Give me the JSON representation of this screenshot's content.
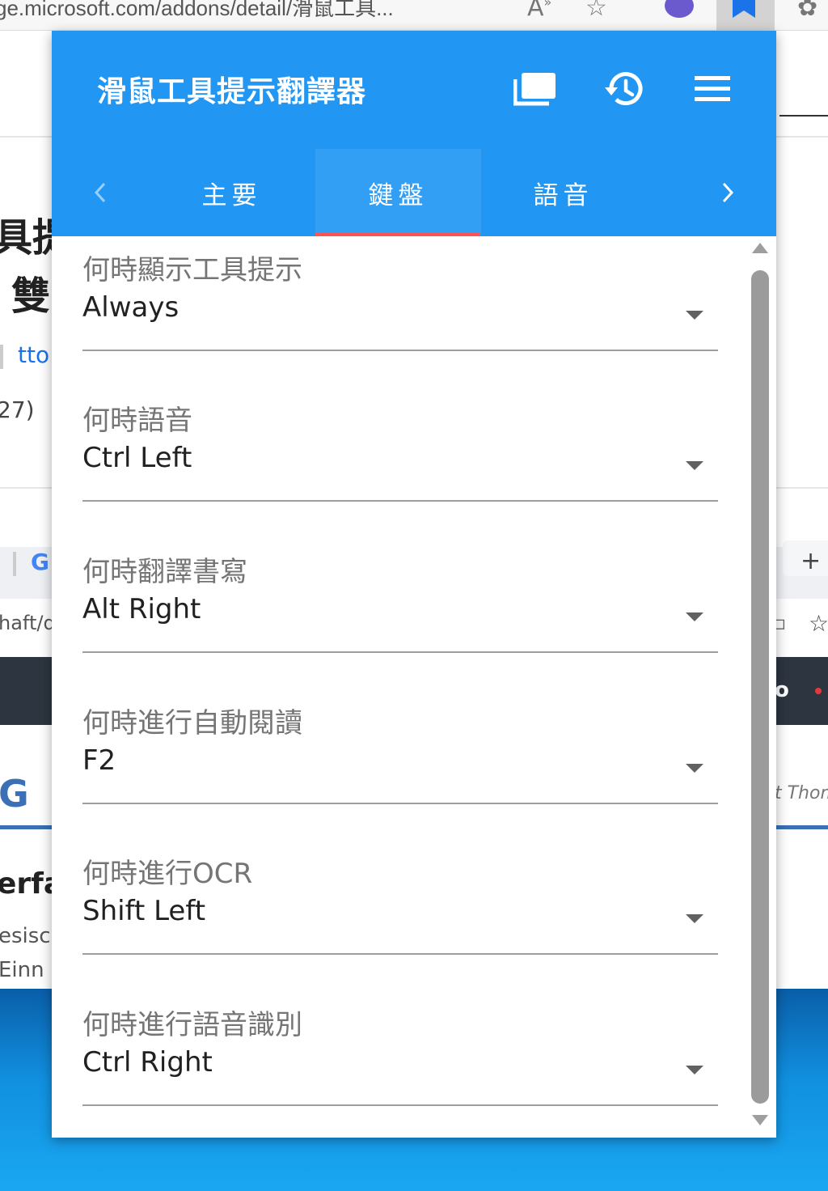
{
  "browser": {
    "address_text": "ge.microsoft.com/addons/detail/滑鼠工具...",
    "read_aloud_icon": "read-aloud-icon",
    "favorite_icon": "star-icon",
    "extensions_icon": "puzzle-icon"
  },
  "background_page": {
    "heading_fragment_1": "具提",
    "heading_fragment_2": "雙",
    "link_fragment": "tto",
    "rating_count_fragment": "27)",
    "bookmark_fragment": "haft/d",
    "logo_fragment": "G",
    "product_fragment": "erfa",
    "text_fragment_1": "esisc",
    "text_fragment_2": "Einn",
    "right_text_fragment": "t Thom",
    "new_tab_symbol": "+",
    "right_dark_fragment": "o"
  },
  "popup": {
    "title": "滑鼠工具提示翻譯器",
    "toolbar_icons": [
      "window-icon",
      "history-icon",
      "menu-icon"
    ],
    "tabs": [
      {
        "label": "主要",
        "active": false
      },
      {
        "label": "鍵盤",
        "active": true
      },
      {
        "label": "語音",
        "active": false
      }
    ],
    "fields": [
      {
        "label": "何時顯示工具提示",
        "value": "Always"
      },
      {
        "label": "何時語音",
        "value": "Ctrl Left"
      },
      {
        "label": "何時翻譯書寫",
        "value": "Alt Right"
      },
      {
        "label": "何時進行自動閱讀",
        "value": "F2"
      },
      {
        "label": "何時進行OCR",
        "value": "Shift Left"
      },
      {
        "label": "何時進行語音識別",
        "value": "Ctrl Right"
      }
    ]
  },
  "colors": {
    "toolbar": "#2196f3",
    "tab_indicator": "#ff5252",
    "label_text": "#757575",
    "value_text": "#212121",
    "underline": "#9e9e9e"
  }
}
